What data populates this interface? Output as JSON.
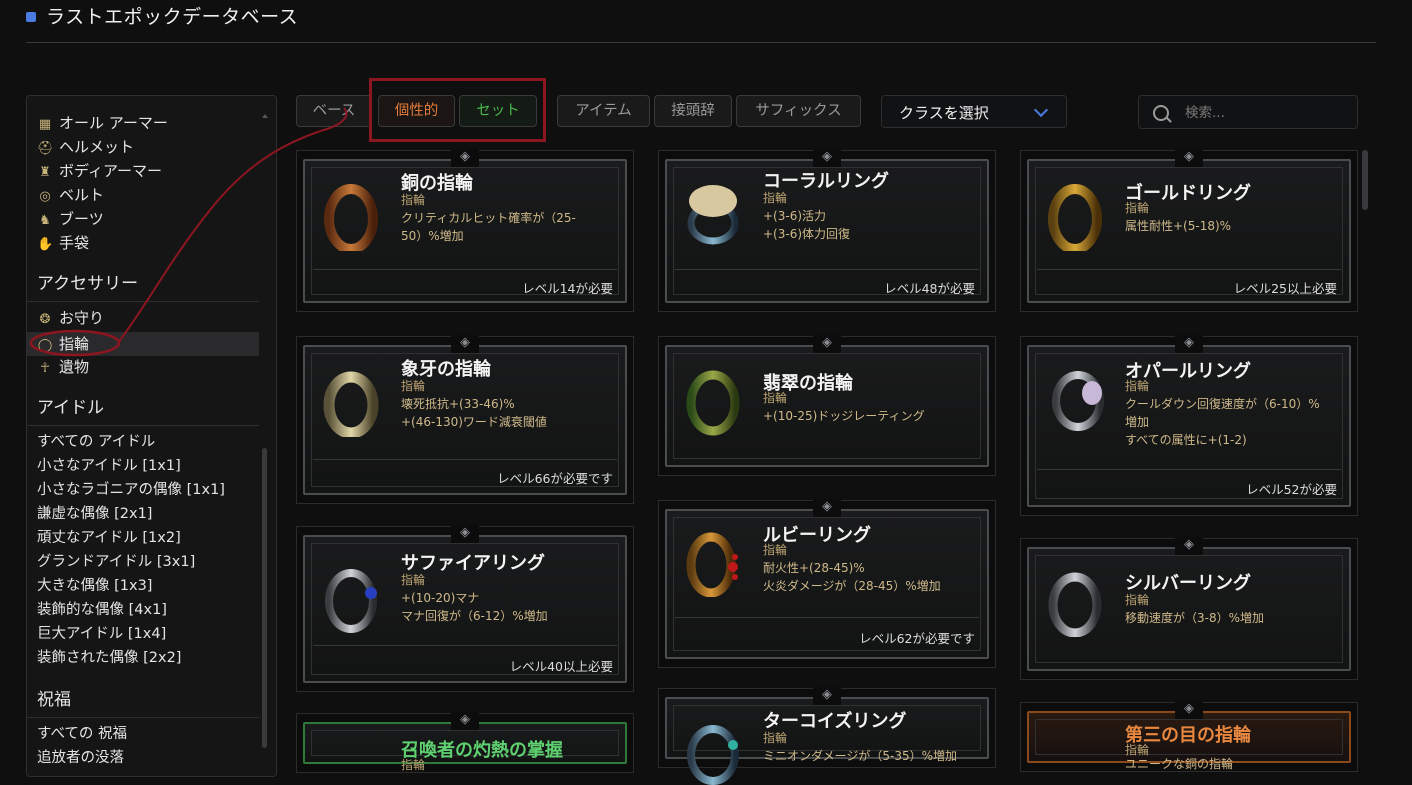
{
  "app": {
    "title": "ラストエポックデータベース"
  },
  "sidebar": {
    "armor_items": [
      {
        "label": "オール アーマー",
        "icon": "grid-icon"
      },
      {
        "label": "ヘルメット",
        "icon": "helmet-icon"
      },
      {
        "label": "ボディアーマー",
        "icon": "body-armor-icon"
      },
      {
        "label": "ベルト",
        "icon": "belt-icon"
      },
      {
        "label": "ブーツ",
        "icon": "boots-icon"
      },
      {
        "label": "手袋",
        "icon": "gloves-icon"
      }
    ],
    "accessory_heading": "アクセサリー",
    "accessory_items": [
      {
        "label": "お守り",
        "icon": "amulet-icon"
      },
      {
        "label": "指輪",
        "icon": "ring-icon",
        "selected": true
      },
      {
        "label": "遺物",
        "icon": "relic-icon"
      }
    ],
    "idol_heading": "アイドル",
    "idol_items": [
      "すべての アイドル",
      "小さなアイドル [1x1]",
      "小さなラゴニアの偶像 [1x1]",
      "謙虚な偶像 [2x1]",
      "頑丈なアイドル [1x2]",
      "グランドアイドル [3x1]",
      "大きな偶像 [1x3]",
      "装飾的な偶像 [4x1]",
      "巨大アイドル [1x4]",
      "装飾された偶像 [2x2]"
    ],
    "blessing_heading": "祝福",
    "blessing_items": [
      "すべての 祝福",
      "追放者の没落"
    ]
  },
  "tabs": {
    "base": "ベース",
    "unique": "個性的",
    "set": "セット",
    "item": "アイテム",
    "prefix": "接頭辞",
    "suffix": "サフィックス"
  },
  "class_select": {
    "label": "クラスを選択"
  },
  "search": {
    "placeholder": "検索..."
  },
  "colors": {
    "accent": "#4a7be0",
    "unique": "#e07a3a",
    "set": "#4cb84c",
    "highlight": "#8c1620",
    "mod_text": "#cfb98a"
  },
  "cards": {
    "c1": {
      "name": "銅の指輪",
      "type": "指輪",
      "mods": [
        "クリティカルヒット確率が（25-",
        "50）%増加"
      ],
      "req": "レベル14が必要"
    },
    "c2": {
      "name": "コーラルリング",
      "type": "指輪",
      "mods": [
        "+(3-6)活力",
        "+(3-6)体力回復"
      ],
      "req": "レベル48が必要"
    },
    "c3": {
      "name": "ゴールドリング",
      "type": "指輪",
      "mods": [
        "属性耐性+(5-18)%"
      ],
      "req": "レベル25以上必要"
    },
    "c4": {
      "name": "象牙の指輪",
      "type": "指輪",
      "mods": [
        "壊死抵抗+(33-46)%",
        "+(46-130)ワード減衰閾値"
      ],
      "req": "レベル66が必要です"
    },
    "c5": {
      "name": "翡翠の指輪",
      "type": "指輪",
      "mods": [
        "+(10-25)ドッジレーティング"
      ],
      "req": ""
    },
    "c6": {
      "name": "オパールリング",
      "type": "指輪",
      "mods": [
        "クールダウン回復速度が（6-10）%",
        "増加",
        "すべての属性に+(1-2)"
      ],
      "req": "レベル52が必要"
    },
    "c7": {
      "name": "サファイアリング",
      "type": "指輪",
      "mods": [
        "+(10-20)マナ",
        "マナ回復が（6-12）%増加"
      ],
      "req": "レベル40以上必要"
    },
    "c8": {
      "name": "ルビーリング",
      "type": "指輪",
      "mods": [
        "耐火性+(28-45)%",
        "火炎ダメージが（28-45）%増加"
      ],
      "req": "レベル62が必要です"
    },
    "c9": {
      "name": "シルバーリング",
      "type": "指輪",
      "mods": [
        "移動速度が（3-8）%増加"
      ],
      "req": ""
    },
    "c10": {
      "name": "召喚者の灼熱の掌握",
      "type": "指輪",
      "mods": [],
      "req": ""
    },
    "c11": {
      "name": "ターコイズリング",
      "type": "指輪",
      "mods": [
        "ミニオンダメージが（5-35）%増加"
      ],
      "req": ""
    },
    "c12": {
      "name": "第三の目の指輪",
      "type": "指輪",
      "mods": [
        "ユニークな銅の指輪"
      ],
      "req": ""
    }
  }
}
